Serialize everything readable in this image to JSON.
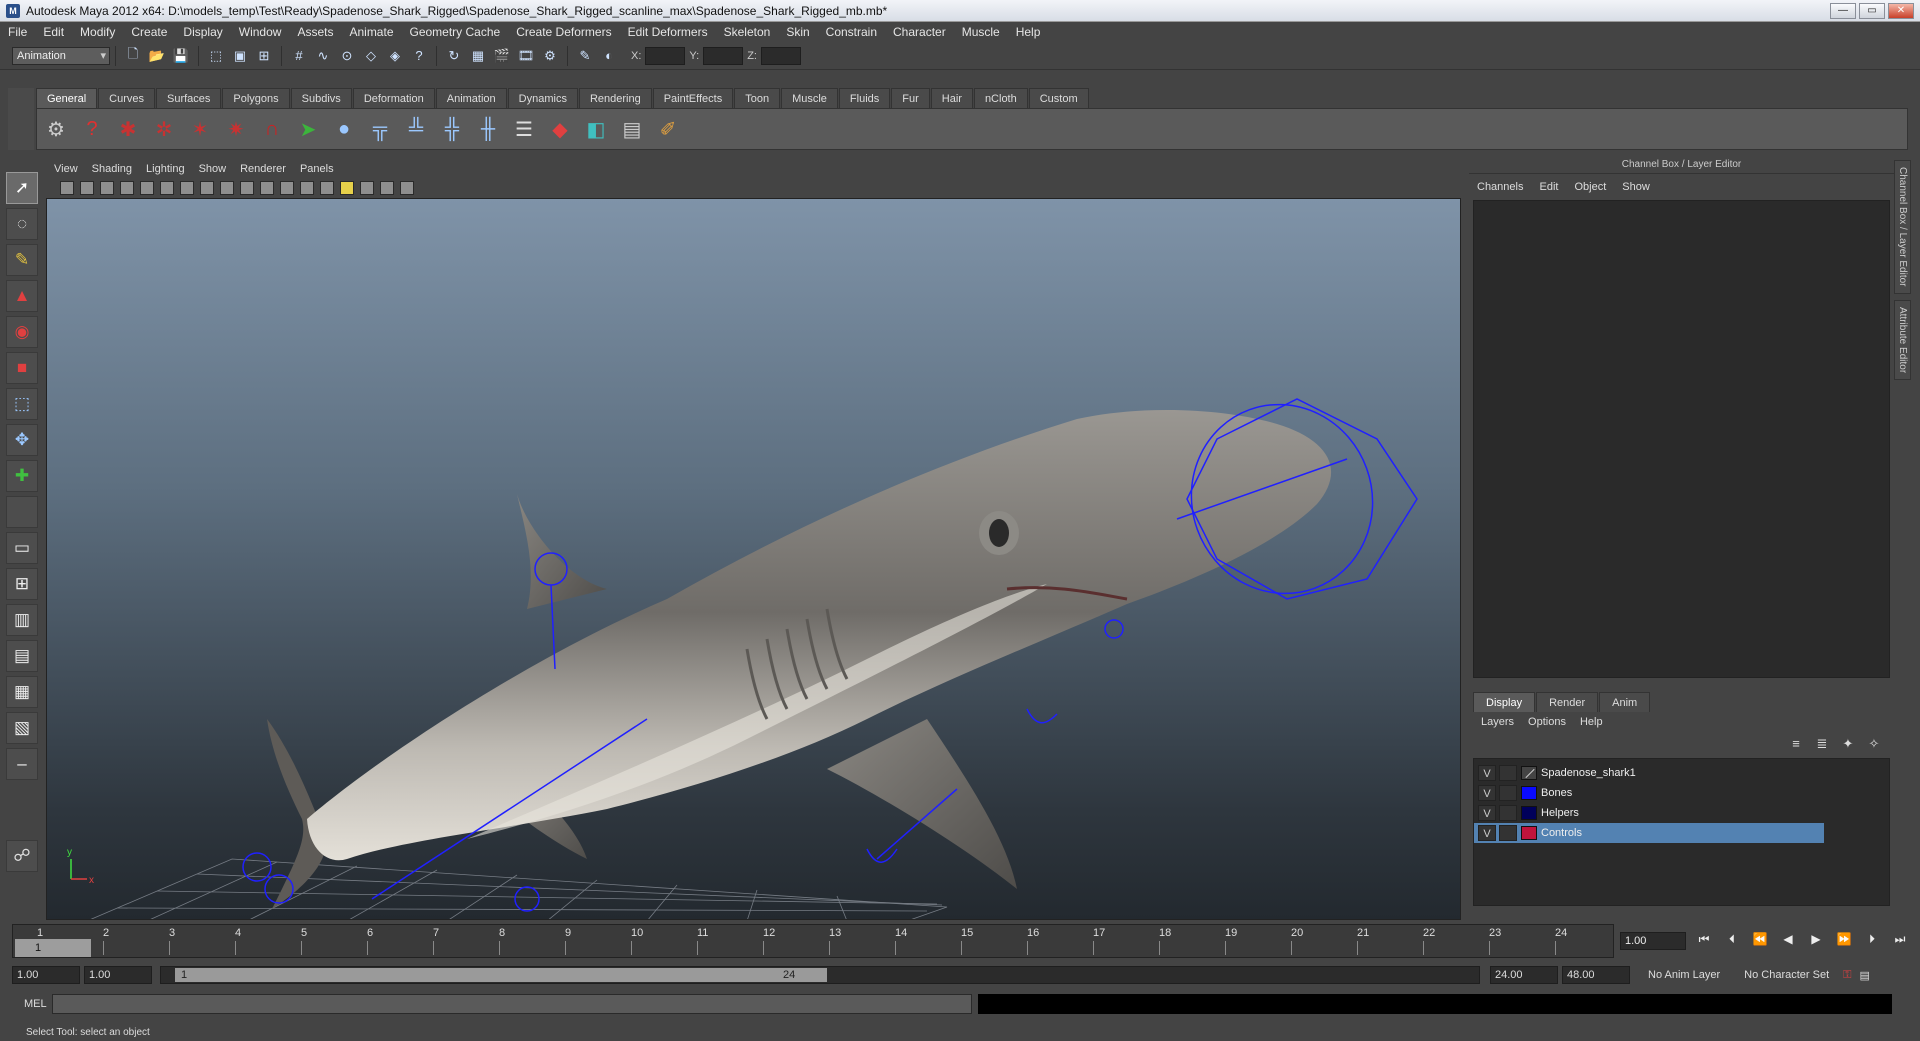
{
  "window": {
    "title": "Autodesk Maya 2012 x64: D:\\models_temp\\Test\\Ready\\Spadenose_Shark_Rigged\\Spadenose_Shark_Rigged_scanline_max\\Spadenose_Shark_Rigged_mb.mb*",
    "min": "—",
    "max": "▭",
    "close": "✕"
  },
  "menu": [
    "File",
    "Edit",
    "Modify",
    "Create",
    "Display",
    "Window",
    "Assets",
    "Animate",
    "Geometry Cache",
    "Create Deformers",
    "Edit Deformers",
    "Skeleton",
    "Skin",
    "Constrain",
    "Character",
    "Muscle",
    "Help"
  ],
  "status": {
    "mode": "Animation",
    "x_label": "X:",
    "y_label": "Y:",
    "z_label": "Z:"
  },
  "shelf_tabs": [
    "General",
    "Curves",
    "Surfaces",
    "Polygons",
    "Subdivs",
    "Deformation",
    "Animation",
    "Dynamics",
    "Rendering",
    "PaintEffects",
    "Toon",
    "Muscle",
    "Fluids",
    "Fur",
    "Hair",
    "nCloth",
    "Custom"
  ],
  "panel_menu": [
    "View",
    "Shading",
    "Lighting",
    "Show",
    "Renderer",
    "Panels"
  ],
  "viewport": {
    "axis_x": "x",
    "axis_y": "y"
  },
  "channel_box": {
    "title": "Channel Box / Layer Editor",
    "menu": [
      "Channels",
      "Edit",
      "Object",
      "Show"
    ]
  },
  "layer_editor": {
    "tabs": [
      "Display",
      "Render",
      "Anim"
    ],
    "menu": [
      "Layers",
      "Options",
      "Help"
    ],
    "layers": [
      {
        "vis": "V",
        "name": "Spadenose_shark1",
        "color": "#444444"
      },
      {
        "vis": "V",
        "name": "Bones",
        "color": "#0a0aff"
      },
      {
        "vis": "V",
        "name": "Helpers",
        "color": "#00005a"
      },
      {
        "vis": "V",
        "name": "Controls",
        "color": "#c0143c"
      }
    ]
  },
  "side_tabs": [
    "Channel Box / Layer Editor",
    "Attribute Editor"
  ],
  "timeline": {
    "ticks": [
      "1",
      "2",
      "3",
      "4",
      "5",
      "6",
      "7",
      "8",
      "9",
      "10",
      "11",
      "12",
      "13",
      "14",
      "15",
      "16",
      "17",
      "18",
      "19",
      "20",
      "21",
      "22",
      "23",
      "24"
    ],
    "current_frame": "1",
    "current_time": "1.00"
  },
  "range": {
    "start": "1.00",
    "playback_start": "1.00",
    "slider_start": "1",
    "slider_end": "24",
    "playback_end": "24.00",
    "end": "48.00",
    "anim_layer": "No Anim Layer",
    "char_set": "No Character Set"
  },
  "cmd": {
    "label": "MEL"
  },
  "help_line": "Select Tool: select an object"
}
